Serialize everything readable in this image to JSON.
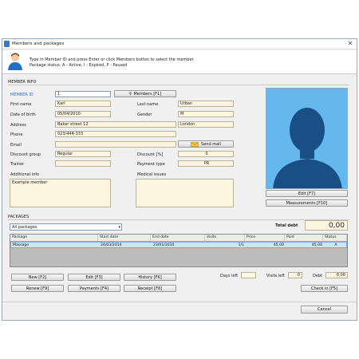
{
  "window": {
    "title": "Members and packages",
    "close_glyph": "✕"
  },
  "header": {
    "line1": "Type in Member ID and press Enter or click Members button to select the member.",
    "line2": "Package status: A - Active, I - Expired, P - Paused",
    "icon": "member-avatar-icon"
  },
  "member_info": {
    "section_label": "MEMBER INFO",
    "member_id_label": "MEMBER ID",
    "member_id_value": "1",
    "members_button": "Members  [F1]",
    "first_name_label": "First name",
    "first_name": "Karl",
    "last_name_label": "Last name",
    "last_name": "Urban",
    "dob_label": "Date of birth",
    "dob": "05/04/2010",
    "gender_label": "Gender",
    "gender": "M",
    "address_label": "Address",
    "address": "Baker street 12",
    "city": "London",
    "phone_label": "Phone",
    "phone": "023/444-333",
    "email_label": "Email",
    "email": "",
    "send_mail_button": "Send mail",
    "discount_group_label": "Discount group",
    "discount_group": "Regular",
    "discount_label": "Discount [%]",
    "discount": "0",
    "trainer_label": "Trainer",
    "trainer": "",
    "payment_type_label": "Payment type",
    "payment_type": "PR",
    "additional_info_label": "Additional info",
    "additional_info": "Example member",
    "medical_issues_label": "Medical issues",
    "medical_issues": "",
    "edit_button": "Edit [F7]",
    "measurements_button": "Measurements [F10]"
  },
  "packages": {
    "section_label": "PACKAGES",
    "filter_value": "All packages",
    "total_debt_label": "Total debt",
    "total_debt": "0,00",
    "columns": [
      "Package",
      "Start date",
      "End date",
      "Visits",
      "Price",
      "Paid",
      "Status"
    ],
    "rows": [
      {
        "package": "Massage",
        "start": "24/03/2014",
        "end": "23/01/3010",
        "visits": "1/1",
        "price": "45.00",
        "paid": "45.00",
        "status": "A"
      }
    ],
    "buttons": {
      "new": "New [F2]",
      "edit": "Edit [F3]",
      "history": "History [F6]",
      "renew": "Renew [F9]",
      "payments": "Payments [F4]",
      "receipt": "Receipt [F8]",
      "check_in": "Check in [F5]"
    },
    "days_left_label": "Days left",
    "days_left": "",
    "visits_left_label": "Visits left",
    "visits_left": "0",
    "debt_label": "Debt",
    "debt": "0,00"
  },
  "footer": {
    "cancel_button": "Cancel"
  },
  "colors": {
    "field_bg": "#fdf5e0",
    "photo_bg": "#64b8ee",
    "selection": "#cfe3f6",
    "accent_label": "#2a6fd6"
  }
}
